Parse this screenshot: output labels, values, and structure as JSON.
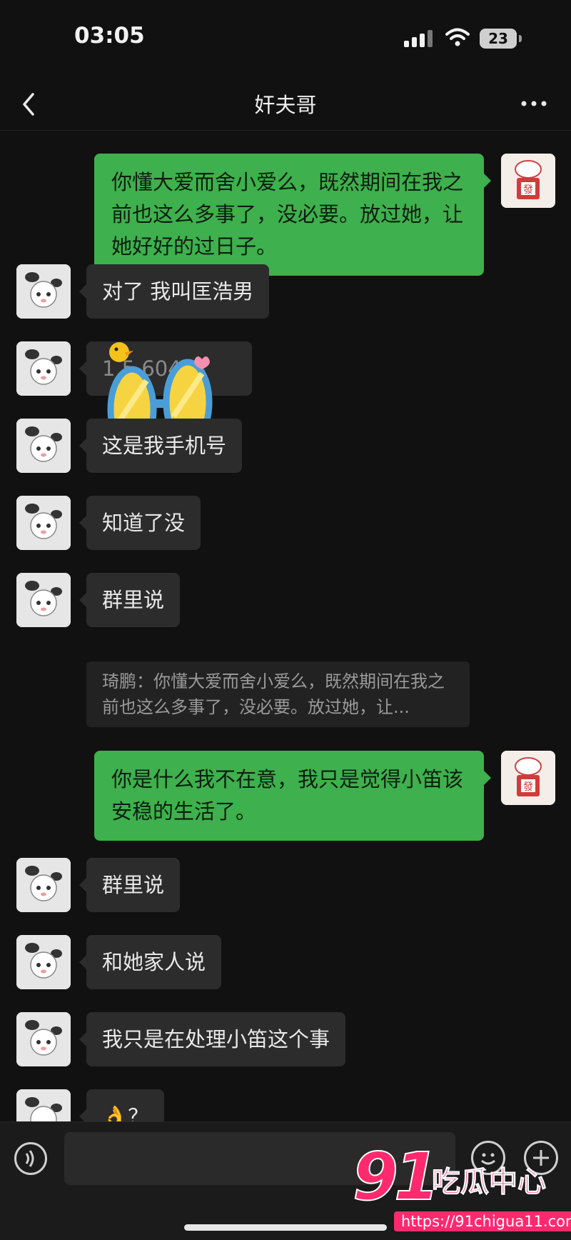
{
  "status": {
    "time": "03:05",
    "battery": "23"
  },
  "header": {
    "title": "奸夫哥"
  },
  "messages": [
    {
      "dir": "out",
      "text": "你懂大爱而舍小爱么，既然期间在我之前也这么多事了，没必要。放过她，让她好好的过日子。"
    },
    {
      "dir": "in",
      "text": "对了 我叫匡浩男"
    },
    {
      "dir": "in",
      "text": "1 5 604"
    },
    {
      "dir": "in",
      "text": "这是我手机号"
    },
    {
      "dir": "in",
      "text": "知道了没"
    },
    {
      "dir": "in",
      "text": "群里说"
    },
    {
      "dir": "quote",
      "text": "琦鹏：你懂大爱而舍小爱么，既然期间在我之前也这么多事了，没必要。放过她，让..."
    },
    {
      "dir": "out",
      "text": "你是什么我不在意，我只是觉得小笛该安稳的生活了。"
    },
    {
      "dir": "in",
      "text": "群里说"
    },
    {
      "dir": "in",
      "text": "和她家人说"
    },
    {
      "dir": "in",
      "text": "我只是在处理小笛这个事"
    },
    {
      "dir": "in",
      "text": "👌？"
    }
  ],
  "watermark": {
    "brand": "91",
    "name": "吃瓜中心",
    "url": "https://91chigua11.com"
  },
  "colors": {
    "background": "#111111",
    "bubble_in": "#2c2c2c",
    "bubble_out": "#3eb04d",
    "watermark": "#ff2a6d"
  }
}
